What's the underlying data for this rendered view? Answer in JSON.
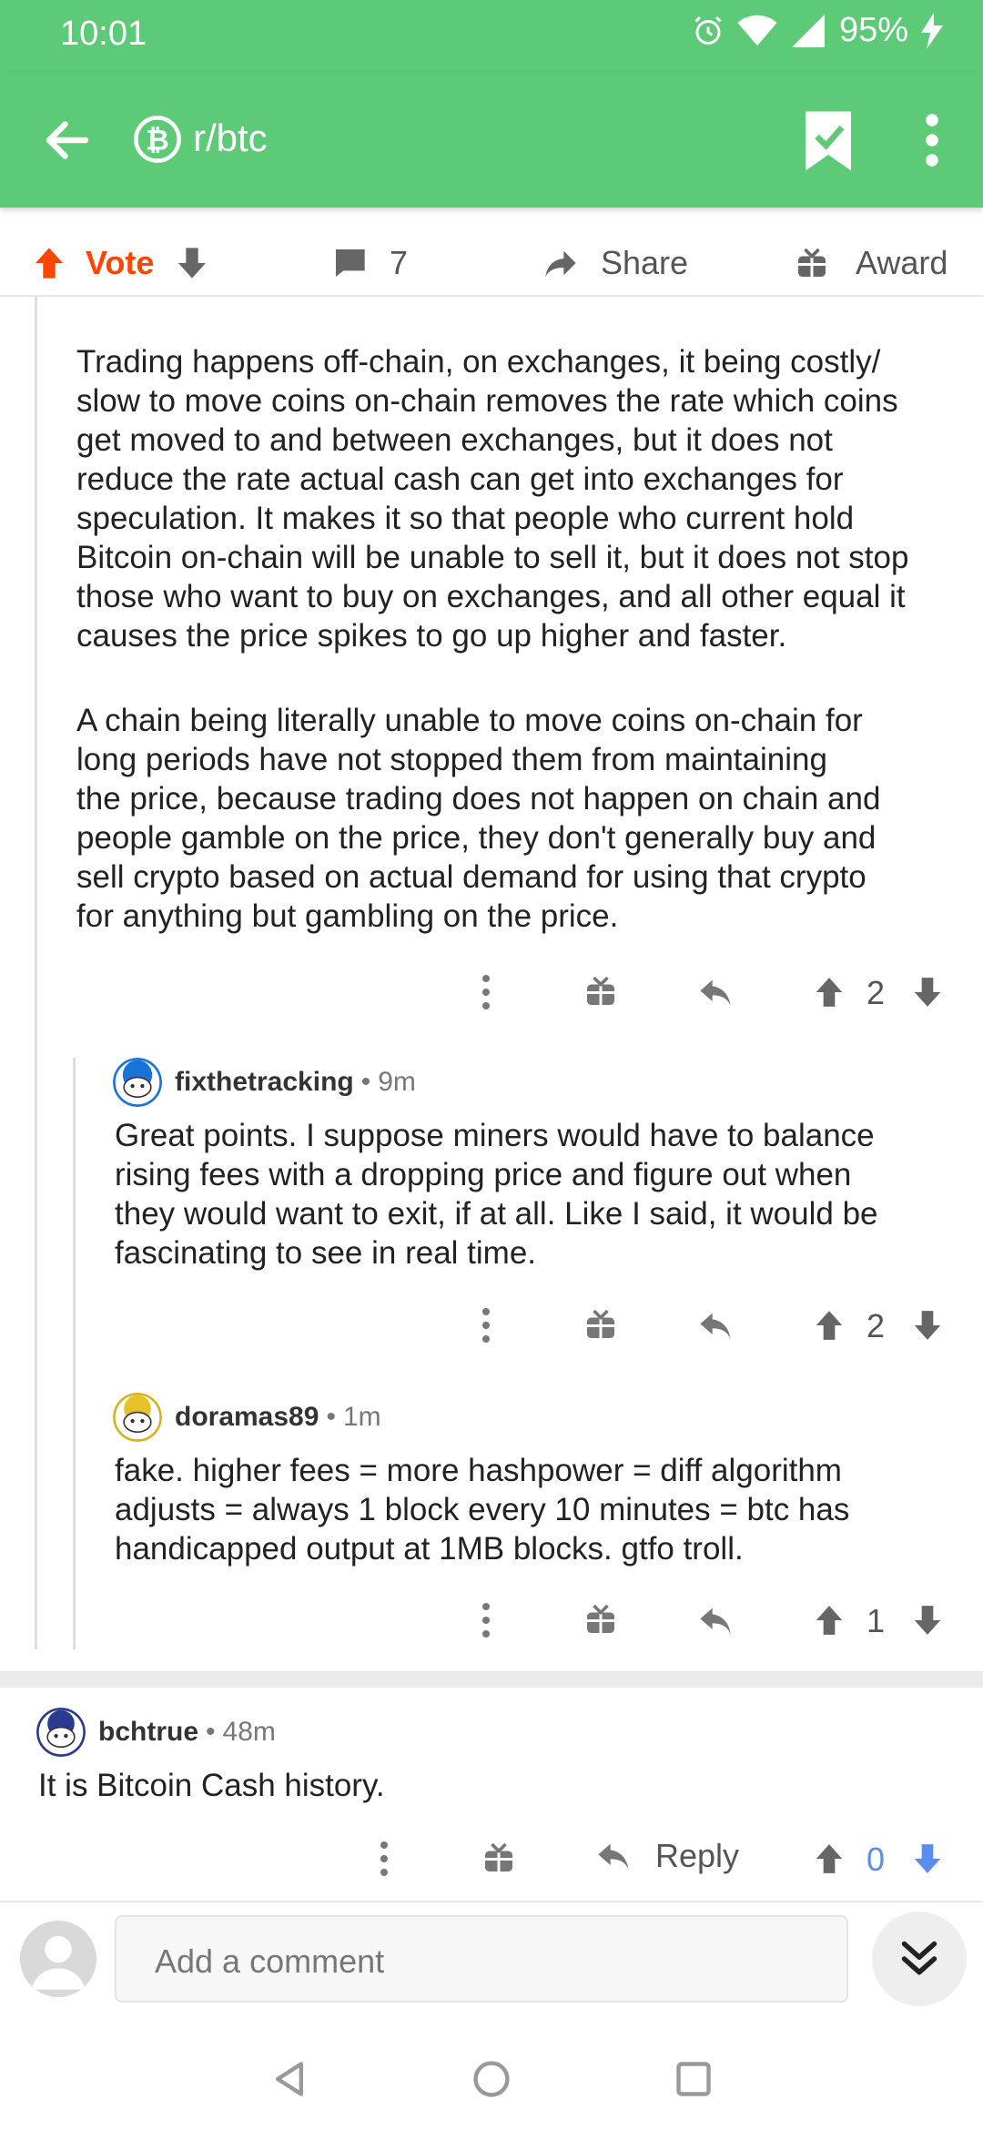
{
  "status": {
    "time": "10:01",
    "battery": "95%"
  },
  "appbar": {
    "subreddit": "r/btc",
    "back_icon": "arrow-left-icon",
    "sub_icon": "bitcoin-icon",
    "bookmark_icon": "bookmark-check-icon",
    "more_icon": "more-vertical-icon"
  },
  "post_actions": {
    "vote": "Vote",
    "comments": "7",
    "share": "Share",
    "award": "Award"
  },
  "parent_comment": {
    "paragraph1": "Trading happens off-chain, on exchanges, it being costly/\nslow to move coins on-chain removes the rate which coins\nget moved to and between exchanges, but it does not\nreduce the rate actual cash can get into exchanges for\nspeculation. It makes it so that people who current hold\nBitcoin on-chain will be unable to sell it, but it does not stop\nthose who want to buy on exchanges, and all other equal it\ncauses the price spikes to go up higher and faster.",
    "paragraph2": "A chain being literally unable to move coins on-chain for\nlong periods have not stopped them from maintaining\nthe price, because trading does not happen on chain and\npeople gamble on the price, they don't generally buy and\nsell crypto based on actual demand for using that crypto\nfor anything but gambling on the price.",
    "score": "2"
  },
  "reply1": {
    "author": "fixthetracking",
    "time": "9m",
    "text": "Great points. I suppose miners would have to balance\nrising fees with a dropping price and figure out when\nthey would want to exit, if at all. Like I said, it would be\nfascinating to see in real time.",
    "score": "2"
  },
  "reply2": {
    "author": "doramas89",
    "time": "1m",
    "text": "fake. higher fees = more hashpower = diff algorithm\nadjusts = always 1 block every 10 minutes = btc has\nhandicapped output at 1MB blocks. gtfo troll.",
    "score": "1"
  },
  "comment3": {
    "author": "bchtrue",
    "time": "48m",
    "text": "It is Bitcoin Cash history.",
    "reply_label": "Reply",
    "score": "0"
  },
  "compose": {
    "placeholder": "Add a comment"
  },
  "colors": {
    "green": "#5cca77",
    "upvote_orange": "#ff4500",
    "downvote_blue": "#5b8def"
  }
}
